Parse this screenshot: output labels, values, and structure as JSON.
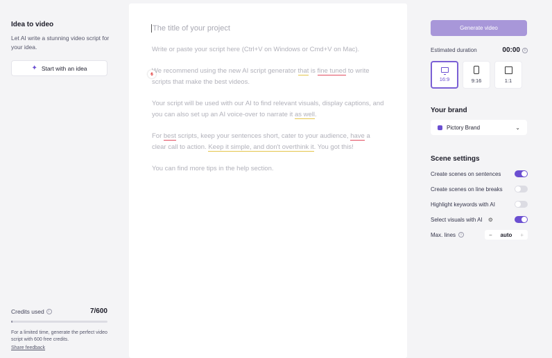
{
  "left": {
    "title": "Idea to video",
    "description": "Let AI write a stunning video script for your idea.",
    "start_button": "Start with an idea",
    "credits_label": "Credits used",
    "credits_value": "7/600",
    "credits_fraction": 0.0117,
    "note": "For a limited time, generate the perfect video script with 600 free credits.",
    "feedback": "Share feedback"
  },
  "editor": {
    "title_placeholder": "The title of your project",
    "badge": "6",
    "p1": "Write or paste your script here (Ctrl+V on Windows or Cmd+V on Mac).",
    "p2": {
      "a": "We recommend using the new AI script generator ",
      "b": "that",
      "c": " is ",
      "d": "fine tuned",
      "e": " to write scripts that make the best videos."
    },
    "p3": {
      "a": "Your script will be used with our AI to find relevant visuals, display captions, and you can also set up an AI voice-over to narrate it ",
      "b": "as well",
      "c": "."
    },
    "p4": {
      "a": "For ",
      "b": "best",
      "c": " scripts, keep your sentences short, cater to your audience, ",
      "d": "have",
      "e": " a clear call to action. ",
      "f": "Keep it simple, and don't overthink it",
      "g": ". You got this!"
    },
    "p5": "You can find more tips in the help section."
  },
  "right": {
    "generate_button": "Generate video",
    "duration_label": "Estimated duration",
    "duration_value": "00:00",
    "ratios": [
      "16:9",
      "9:16",
      "1:1"
    ],
    "brand_title": "Your brand",
    "brand_name": "Pictory Brand",
    "scene_title": "Scene settings",
    "settings": [
      {
        "label": "Create scenes on sentences",
        "on": true
      },
      {
        "label": "Create scenes on line breaks",
        "on": false
      },
      {
        "label": "Highlight keywords with AI",
        "on": false
      },
      {
        "label": "Select visuals with AI",
        "on": true
      }
    ],
    "max_lines_label": "Max. lines",
    "max_lines_value": "auto",
    "minus": "−",
    "plus": "+"
  },
  "colors": {
    "accent": "#6b4fd1",
    "generate_bg": "#a897d9",
    "underline_yellow": "#e4c54a",
    "underline_red": "#e24b5f"
  }
}
